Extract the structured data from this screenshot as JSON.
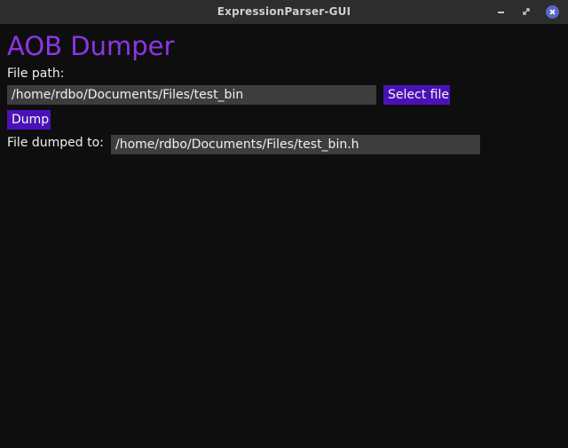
{
  "window": {
    "title": "ExpressionParser-GUI"
  },
  "app": {
    "title": "AOB Dumper",
    "title_color": "#8e35e6",
    "accent_button_color": "#4a12b6"
  },
  "file_path": {
    "label": "File path:",
    "value": "/home/rdbo/Documents/Files/test_bin",
    "select_button_label": "Select file"
  },
  "dump": {
    "button_label": "Dump"
  },
  "output": {
    "label": "File dumped to:",
    "value": "/home/rdbo/Documents/Files/test_bin.h"
  },
  "icons": {
    "minimize": "minimize-icon",
    "restore": "restore-icon",
    "close": "close-icon"
  }
}
